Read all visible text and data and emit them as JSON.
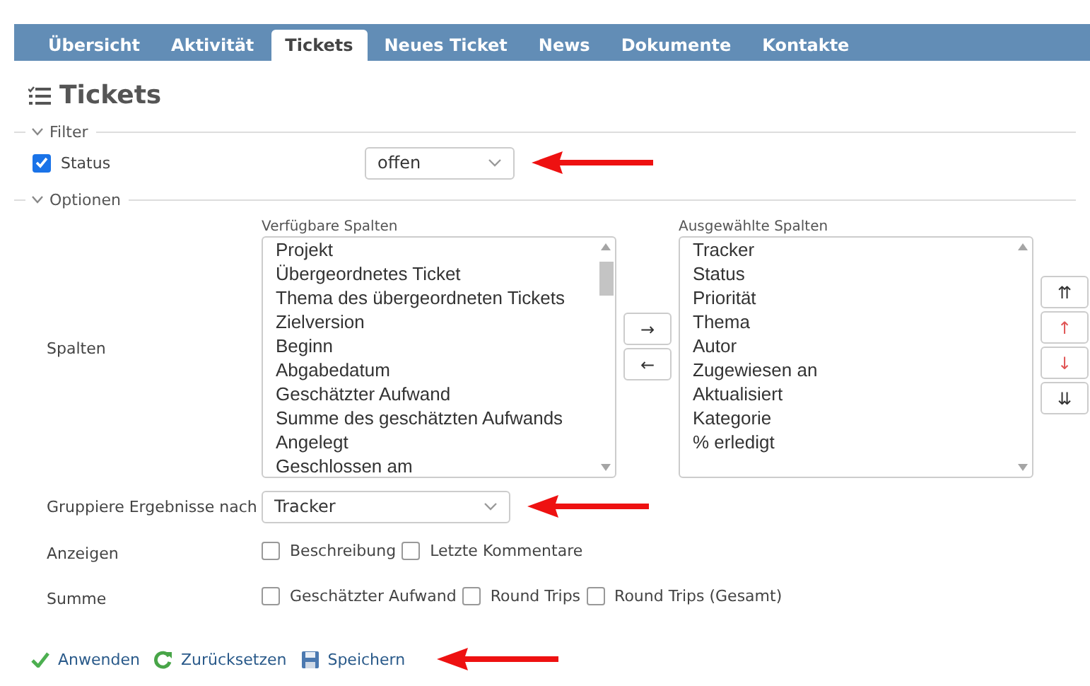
{
  "tabs": [
    {
      "label": "Übersicht",
      "selected": false
    },
    {
      "label": "Aktivität",
      "selected": false
    },
    {
      "label": "Tickets",
      "selected": true
    },
    {
      "label": "Neues Ticket",
      "selected": false
    },
    {
      "label": "News",
      "selected": false
    },
    {
      "label": "Dokumente",
      "selected": false
    },
    {
      "label": "Kontakte",
      "selected": false
    }
  ],
  "title": "Tickets",
  "filter": {
    "legend": "Filter",
    "expanded": true,
    "status": {
      "label": "Status",
      "checked": true,
      "value": "offen"
    }
  },
  "options": {
    "legend": "Optionen",
    "expanded": true,
    "columns": {
      "label": "Spalten",
      "available_title": "Verfügbare Spalten",
      "available": [
        "Projekt",
        "Übergeordnetes Ticket",
        "Thema des übergeordneten Tickets",
        "Zielversion",
        "Beginn",
        "Abgabedatum",
        "Geschätzter Aufwand",
        "Summe des geschätzten Aufwands",
        "Angelegt",
        "Geschlossen am"
      ],
      "selected_title": "Ausgewählte Spalten",
      "selected": [
        "Tracker",
        "Status",
        "Priorität",
        "Thema",
        "Autor",
        "Zugewiesen an",
        "Aktualisiert",
        "Kategorie",
        "% erledigt"
      ],
      "move_buttons": [
        "→",
        "←"
      ],
      "order_buttons": [
        {
          "glyph": "⇈",
          "kind": "double"
        },
        {
          "glyph": "↑",
          "kind": "single"
        },
        {
          "glyph": "↓",
          "kind": "single"
        },
        {
          "glyph": "⇊",
          "kind": "double"
        }
      ]
    },
    "group": {
      "label": "Gruppiere Ergebnisse nach",
      "value": "Tracker"
    },
    "show": {
      "label": "Anzeigen",
      "options": [
        {
          "label": "Beschreibung",
          "checked": false
        },
        {
          "label": "Letzte Kommentare",
          "checked": false
        }
      ]
    },
    "totals": {
      "label": "Summe",
      "options": [
        {
          "label": "Geschätzter Aufwand",
          "checked": false
        },
        {
          "label": "Round Trips",
          "checked": false
        },
        {
          "label": "Round Trips (Gesamt)",
          "checked": false
        }
      ]
    }
  },
  "actions": [
    {
      "label": "Anwenden",
      "kind": "apply"
    },
    {
      "label": "Zurücksetzen",
      "kind": "reset"
    },
    {
      "label": "Speichern",
      "kind": "save"
    }
  ]
}
